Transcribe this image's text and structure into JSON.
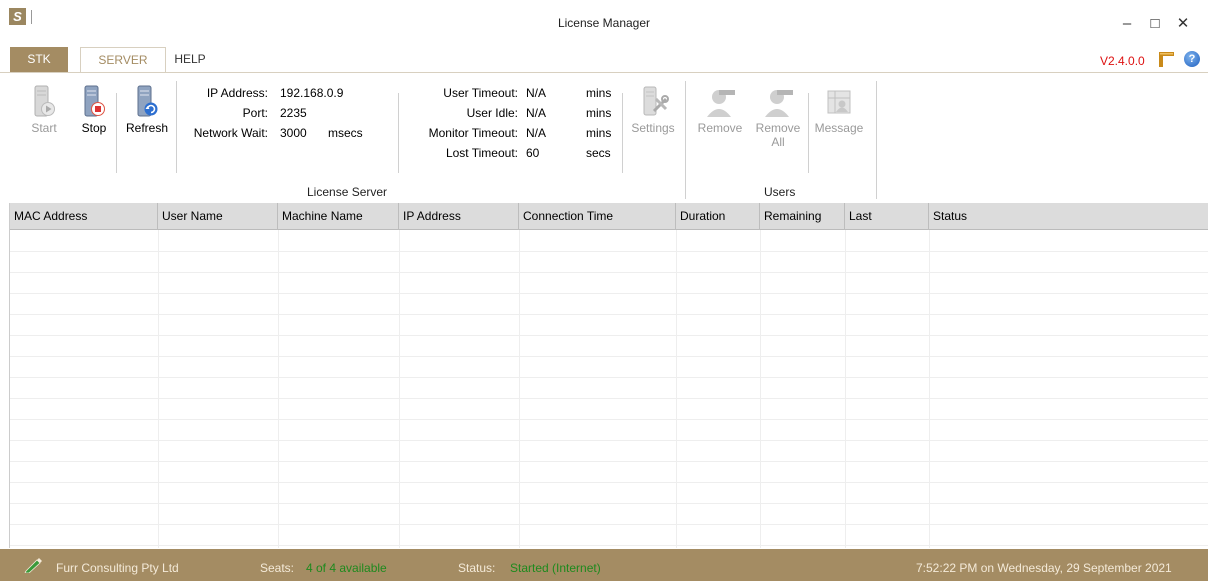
{
  "window": {
    "title": "License Manager"
  },
  "tabs": [
    {
      "label": "STK"
    },
    {
      "label": "SERVER"
    },
    {
      "label": "HELP"
    }
  ],
  "version": "V2.4.0.0",
  "toolbar": {
    "start_label": "Start",
    "stop_label": "Stop",
    "refresh_label": "Refresh",
    "settings_label": "Settings",
    "remove_label": "Remove",
    "remove_all_label_1": "Remove",
    "remove_all_label_2": "All",
    "message_label": "Message"
  },
  "license_server": {
    "group_label": "License Server",
    "ip_label": "IP Address:",
    "ip_value": "192.168.0.9",
    "port_label": "Port:",
    "port_value": "2235",
    "network_wait_label": "Network Wait:",
    "network_wait_value": "3000",
    "network_wait_unit": "msecs",
    "user_timeout_label": "User Timeout:",
    "user_timeout_value": "N/A",
    "user_timeout_unit": "mins",
    "user_idle_label": "User Idle:",
    "user_idle_value": "N/A",
    "user_idle_unit": "mins",
    "monitor_timeout_label": "Monitor Timeout:",
    "monitor_timeout_value": "N/A",
    "monitor_timeout_unit": "mins",
    "lost_timeout_label": "Lost Timeout:",
    "lost_timeout_value": "60",
    "lost_timeout_unit": "secs"
  },
  "users": {
    "group_label": "Users"
  },
  "table": {
    "columns": [
      "MAC Address",
      "User Name",
      "Machine Name",
      "IP Address",
      "Connection Time",
      "Duration",
      "Remaining",
      "Last",
      "Status"
    ]
  },
  "statusbar": {
    "company": "Furr Consulting Pty Ltd",
    "seats_label": "Seats:",
    "seats_value": "4 of 4 available",
    "status_label": "Status:",
    "status_value": "Started (Internet)",
    "datetime": "7:52:22 PM on Wednesday, 29 September 2021"
  },
  "colors": {
    "accent": "#a48c63",
    "version_red": "#dd1111",
    "status_green": "#1e8a1e"
  }
}
